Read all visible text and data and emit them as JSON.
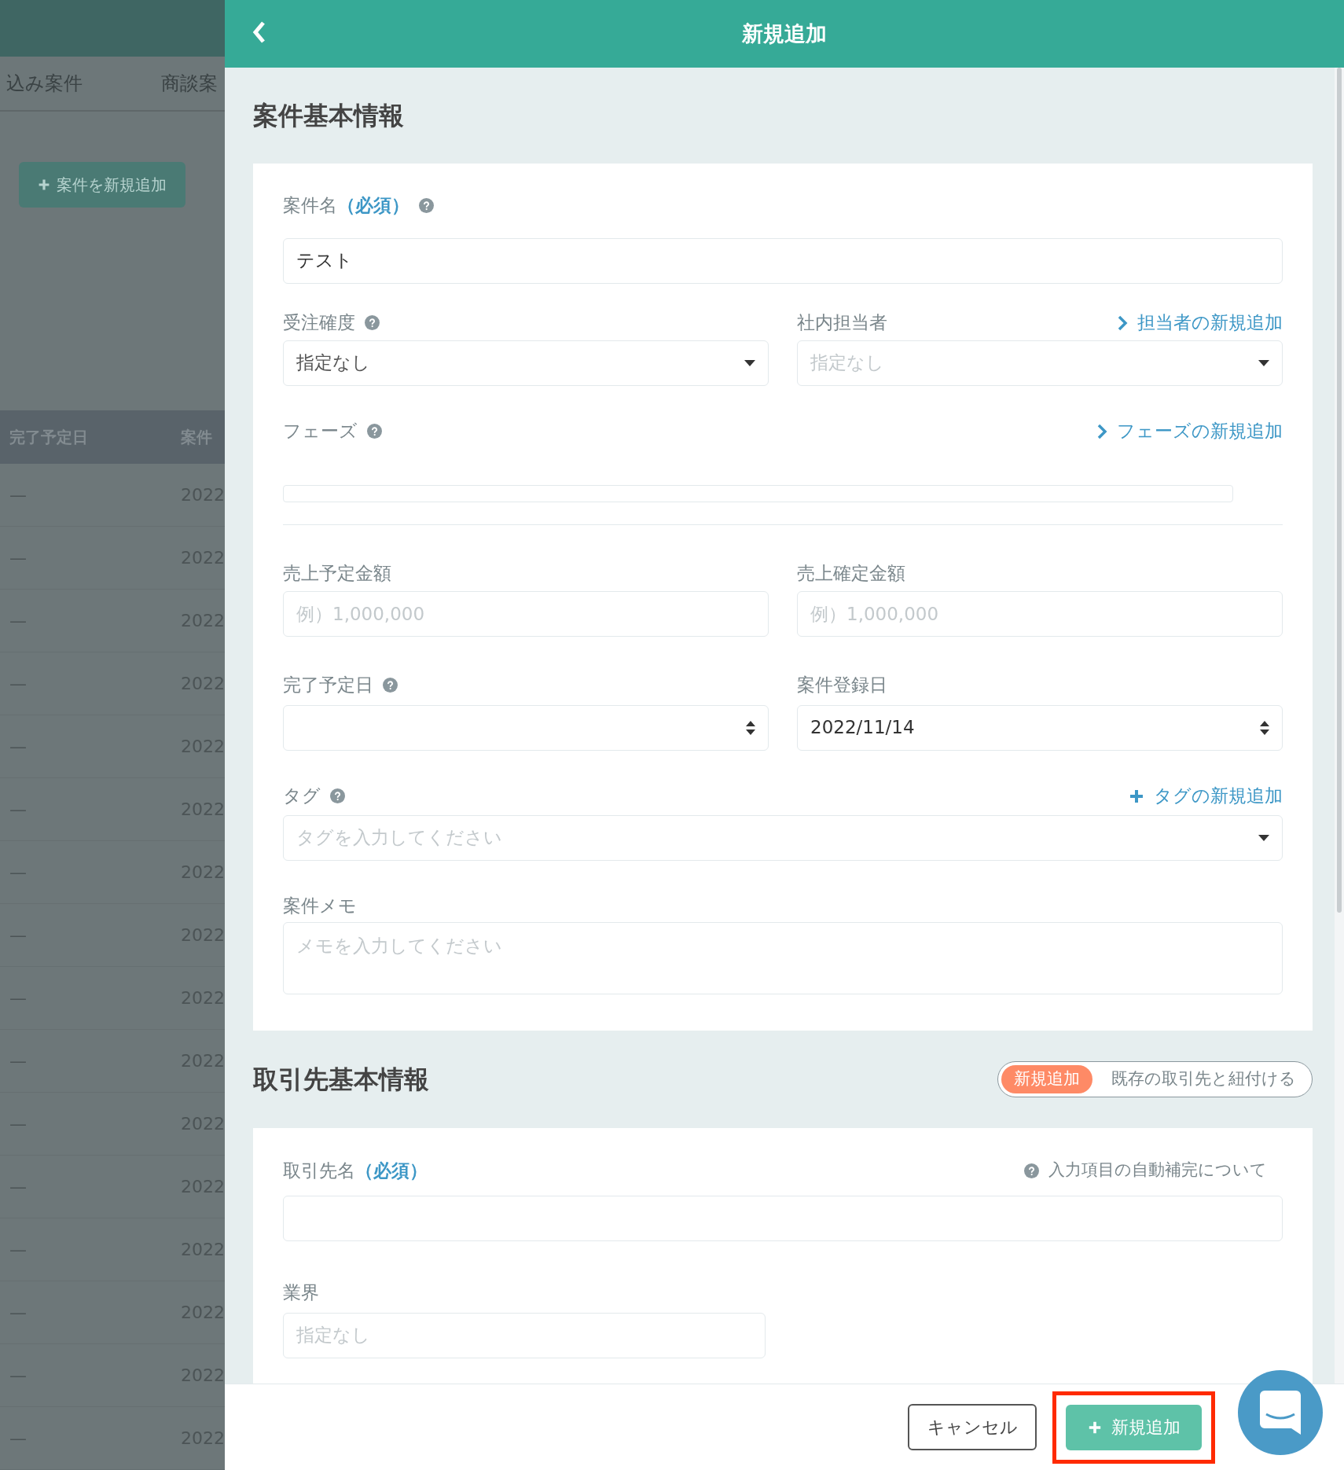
{
  "background": {
    "tabs": [
      {
        "label": "込み案件"
      },
      {
        "label": "商談案"
      }
    ],
    "add_button": "案件を新規追加",
    "table": {
      "columns": [
        "完了予定日",
        "案件"
      ],
      "rows": [
        {
          "due": "—",
          "created": "2022"
        },
        {
          "due": "—",
          "created": "2022"
        },
        {
          "due": "—",
          "created": "2022"
        },
        {
          "due": "—",
          "created": "2022"
        },
        {
          "due": "—",
          "created": "2022"
        },
        {
          "due": "—",
          "created": "2022"
        },
        {
          "due": "—",
          "created": "2022"
        },
        {
          "due": "—",
          "created": "2022"
        },
        {
          "due": "—",
          "created": "2022"
        },
        {
          "due": "—",
          "created": "2022"
        },
        {
          "due": "—",
          "created": "2022"
        },
        {
          "due": "—",
          "created": "2022"
        },
        {
          "due": "—",
          "created": "2022"
        },
        {
          "due": "—",
          "created": "2022"
        },
        {
          "due": "—",
          "created": "2022"
        },
        {
          "due": "—",
          "created": "2022"
        }
      ]
    }
  },
  "panel": {
    "title": "新規追加",
    "deal_section": {
      "title": "案件基本情報",
      "deal_name": {
        "label": "案件名",
        "required": "（必須）",
        "value": "テスト"
      },
      "probability": {
        "label": "受注確度",
        "value": "指定なし"
      },
      "owner": {
        "label": "社内担当者",
        "link": "担当者の新規追加",
        "placeholder": "指定なし"
      },
      "phase": {
        "label": "フェーズ",
        "link": "フェーズの新規追加"
      },
      "expected_amount": {
        "label": "売上予定金額",
        "placeholder": "例）1,000,000"
      },
      "confirmed_amount": {
        "label": "売上確定金額",
        "placeholder": "例）1,000,000"
      },
      "due_date": {
        "label": "完了予定日"
      },
      "registered_date": {
        "label": "案件登録日",
        "value": "2022/11/14"
      },
      "tags": {
        "label": "タグ",
        "link": "タグの新規追加",
        "placeholder": "タグを入力してください"
      },
      "memo": {
        "label": "案件メモ",
        "placeholder": "メモを入力してください"
      }
    },
    "client_section": {
      "title": "取引先基本情報",
      "modes": [
        {
          "label": "新規追加",
          "selected": true
        },
        {
          "label": "既存の取引先と紐付ける",
          "selected": false
        }
      ],
      "client_name": {
        "label": "取引先名",
        "required": "（必須）",
        "help": "入力項目の自動補完について"
      },
      "industry": {
        "label": "業界",
        "placeholder": "指定なし"
      }
    },
    "footer": {
      "cancel": "キャンセル",
      "submit": "新規追加"
    }
  }
}
